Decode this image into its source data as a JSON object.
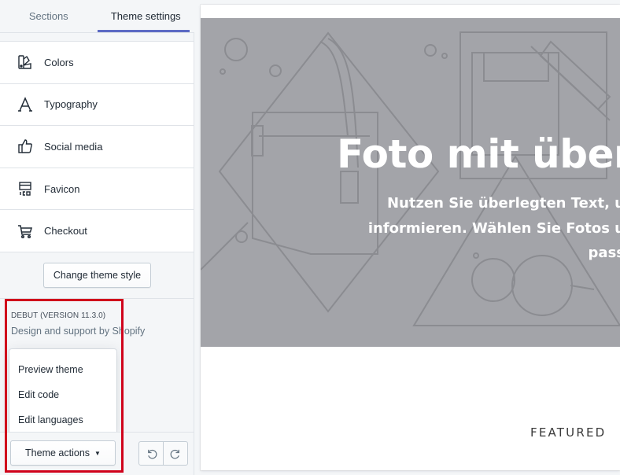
{
  "tabs": [
    {
      "label": "Sections"
    },
    {
      "label": "Theme settings"
    }
  ],
  "menu": [
    {
      "label": "Colors",
      "icon": "colors-icon"
    },
    {
      "label": "Typography",
      "icon": "typography-icon"
    },
    {
      "label": "Social media",
      "icon": "thumbs-up-icon"
    },
    {
      "label": "Favicon",
      "icon": "favicon-icon"
    },
    {
      "label": "Checkout",
      "icon": "cart-icon"
    }
  ],
  "change_theme_style": "Change theme style",
  "theme_info": {
    "name": "DEBUT (VERSION 11.3.0)",
    "support": "Design and support by Shopify"
  },
  "theme_actions_menu": [
    {
      "label": "Preview theme"
    },
    {
      "label": "Edit code"
    },
    {
      "label": "Edit languages"
    }
  ],
  "footer": {
    "theme_actions_label": "Theme actions",
    "undo_icon": "undo-icon",
    "redo_icon": "redo-icon"
  },
  "preview": {
    "hero_title": "Foto mit überl",
    "hero_sub_lines": [
      "Nutzen Sie überlegten Text, u",
      "informieren. Wählen Sie Fotos u",
      "pass"
    ],
    "featured": "FEATURED"
  },
  "colors": {
    "accent": "#5c6ac4",
    "highlight_box": "#d0021b",
    "hero_bg": "#a3a4a9"
  }
}
